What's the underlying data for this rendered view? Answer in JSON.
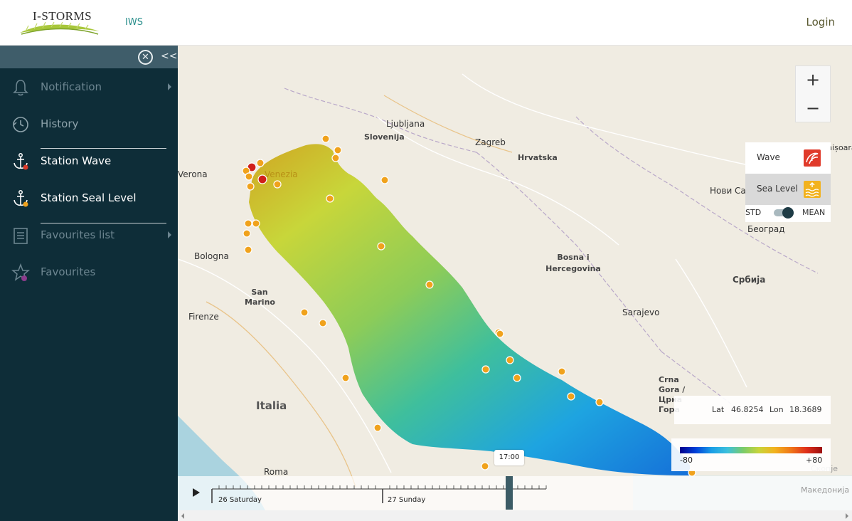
{
  "header": {
    "logo_text": "I-STORMS",
    "nav_link": "IWS",
    "login_label": "Login"
  },
  "sidebar": {
    "close_icon": "circle-x-icon",
    "collapse_label": "<<",
    "items": [
      {
        "label": "Notification",
        "icon": "bell-icon",
        "active": false
      },
      {
        "label": "History",
        "icon": "clock-history-icon",
        "active": false
      },
      {
        "label": "Station Wave",
        "icon": "anchor-red-icon",
        "active": true
      },
      {
        "label": "Station Seal Level",
        "icon": "anchor-orange-icon",
        "active": true
      },
      {
        "label": "Favourites list",
        "icon": "list-icon",
        "active": false
      },
      {
        "label": "Favourites",
        "icon": "star-icon",
        "active": false
      }
    ]
  },
  "map": {
    "places": [
      "Ljubljana",
      "Slovenija",
      "Zagreb",
      "Hrvatska",
      "Timișoara",
      "Нови Сад",
      "Београд",
      "Bosna i Hercegovina",
      "Србија",
      "Sarajevo",
      "Crna Gora / Црна Гора",
      "Verona",
      "Venezia",
      "Bologna",
      "San Marino",
      "Firenze",
      "Italia",
      "Roma",
      "Македонија",
      "Скопје"
    ],
    "layers": {
      "wave_label": "Wave",
      "sea_level_label": "Sea Level",
      "toggle_left": "STD",
      "toggle_right": "MEAN",
      "toggle_state": "MEAN"
    },
    "coords": {
      "lat_label": "Lat",
      "lat_value": "46.8254",
      "lon_label": "Lon",
      "lon_value": "18.3689"
    },
    "legend": {
      "min": "-80",
      "max": "+80",
      "colors": [
        "#00008c",
        "#0040d8",
        "#1a9ee6",
        "#3cc0dc",
        "#7acb6a",
        "#c8d43a",
        "#f2b21e",
        "#f07818",
        "#e0301a",
        "#9c0e0e"
      ]
    },
    "timeline": {
      "day1": "26 Saturday",
      "day2": "27 Sunday",
      "current_time": "17:00"
    },
    "station_colors": {
      "normal": "#f0a21c",
      "alert": "#d0201a"
    }
  }
}
